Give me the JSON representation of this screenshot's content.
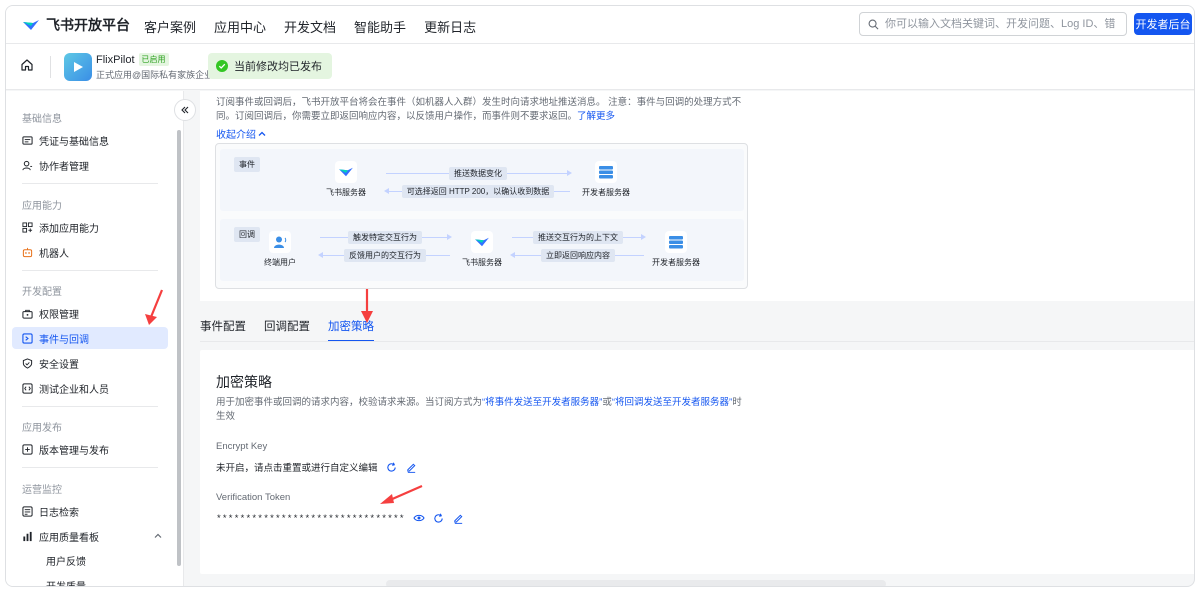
{
  "topnav": {
    "brand": "飞书开放平台",
    "links": [
      "客户案例",
      "应用中心",
      "开发文档",
      "智能助手",
      "更新日志"
    ],
    "search_placeholder": "你可以输入文档关键词、开发问题、Log ID、错误码",
    "dev_button": "开发者后台"
  },
  "appbar": {
    "app_name": "FlixPilot",
    "status_badge": "已启用",
    "app_sub": "正式应用@国际私有家族企业",
    "publish_status": "当前修改均已发布"
  },
  "sidebar": {
    "sections": [
      {
        "title": "基础信息",
        "items": [
          "凭证与基础信息",
          "协作者管理"
        ]
      },
      {
        "title": "应用能力",
        "items": [
          "添加应用能力",
          "机器人"
        ]
      },
      {
        "title": "开发配置",
        "items": [
          "权限管理",
          "事件与回调",
          "安全设置",
          "测试企业和人员"
        ]
      },
      {
        "title": "应用发布",
        "items": [
          "版本管理与发布"
        ]
      },
      {
        "title": "运营监控",
        "items": [
          "日志检索",
          "应用质量看板",
          "用户反馈",
          "开发质量"
        ]
      }
    ],
    "active_item": "事件与回调"
  },
  "intro": {
    "text": "订阅事件或回调后，飞书开放平台将会在事件（如机器人入群）发生时向请求地址推送消息。 注意：事件与回调的处理方式不同。订阅回调后，你需要立即返回响应内容，以反馈用户操作，而事件则不要求返回。",
    "learn_more": "了解更多",
    "collapse": "收起介绍"
  },
  "diagram": {
    "event_tag": "事件",
    "callback_tag": "回调",
    "event_row": {
      "source": "飞书服务器",
      "target": "开发者服务器",
      "push": "推送数据变化",
      "reply": "可选择返回 HTTP 200，以确认收到数据"
    },
    "callback_row": {
      "user": "终端用户",
      "server": "飞书服务器",
      "dev": "开发者服务器",
      "trigger": "触发特定交互行为",
      "feedback": "反馈用户的交互行为",
      "push_ctx": "推送交互行为的上下文",
      "respond": "立即返回响应内容"
    }
  },
  "tabs": [
    "事件配置",
    "回调配置",
    "加密策略"
  ],
  "active_tab": "加密策略",
  "encryption": {
    "title": "加密策略",
    "desc_prefix": "用于加密事件或回调的请求内容，校验请求来源。当订阅方式为",
    "desc_hl1": "“将事件发送至开发者服务器”",
    "desc_mid": "或",
    "desc_hl2": "“将回调发送至开发者服务器”",
    "desc_suffix": "时生效",
    "encrypt_key_label": "Encrypt Key",
    "encrypt_key_value": "未开启，请点击重置或进行自定义编辑",
    "token_label": "Verification Token",
    "token_value": "********************************"
  },
  "colors": {
    "accent": "#1456f0",
    "active_bg": "#e1eaff",
    "success_bg": "#e4f5e0",
    "annotation": "#f53f3f"
  }
}
